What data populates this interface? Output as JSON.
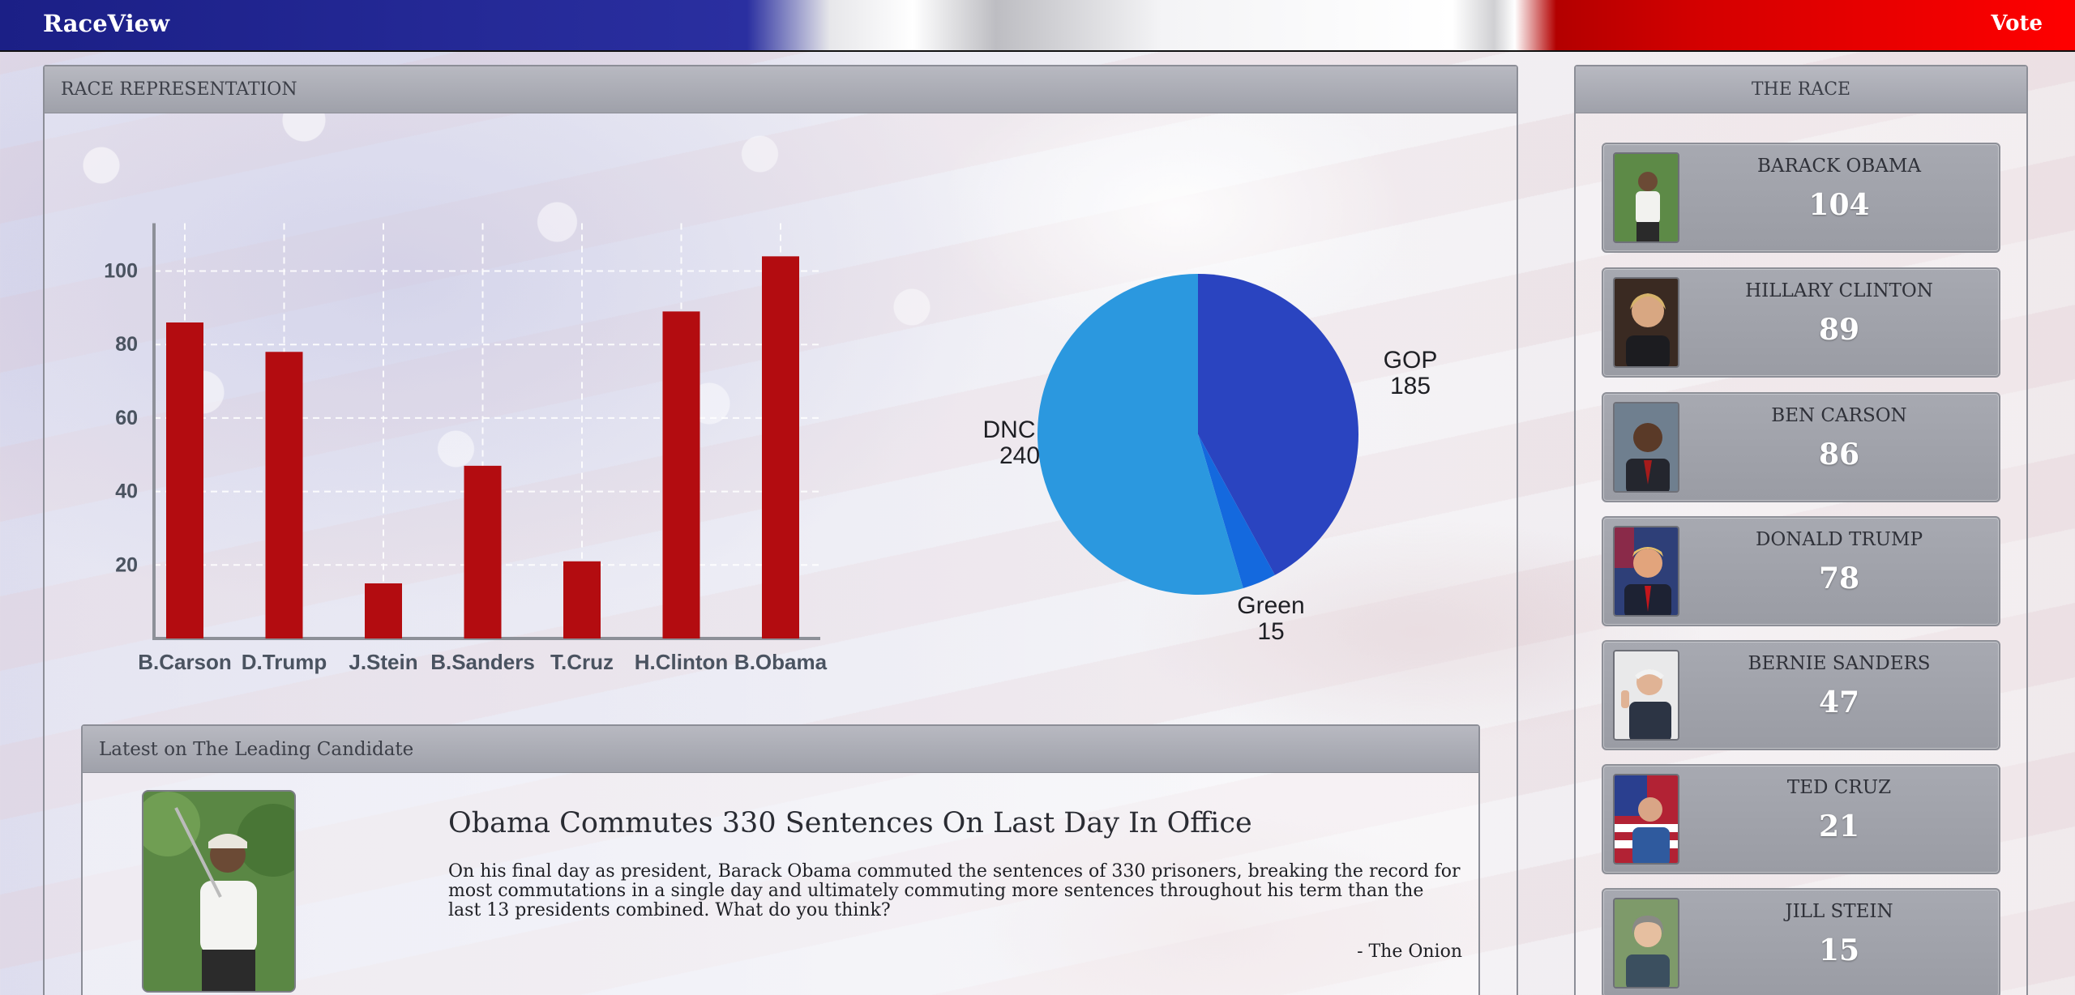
{
  "navbar": {
    "brand": "RaceView",
    "vote_label": "Vote"
  },
  "race_panel": {
    "title": "RACE REPRESENTATION"
  },
  "the_race_panel": {
    "title": "THE RACE"
  },
  "news": {
    "header": "Latest on The Leading Candidate",
    "title": "Obama Commutes 330 Sentences On Last Day In Office",
    "body": "On his final day as president, Barack Obama commuted the sentences of 330 prisoners, breaking the record for most commutations in a single day and ultimately commuting more sentences throughout his term than the last 13 presidents combined. What do you think?",
    "source": "- The Onion"
  },
  "candidates": [
    {
      "name": "BARACK OBAMA",
      "votes": "104"
    },
    {
      "name": "HILLARY CLINTON",
      "votes": "89"
    },
    {
      "name": "BEN CARSON",
      "votes": "86"
    },
    {
      "name": "DONALD TRUMP",
      "votes": "78"
    },
    {
      "name": "BERNIE SANDERS",
      "votes": "47"
    },
    {
      "name": "TED CRUZ",
      "votes": "21"
    },
    {
      "name": "JILL STEIN",
      "votes": "15"
    }
  ],
  "chart_data": [
    {
      "type": "bar",
      "categories": [
        "B.Carson",
        "D.Trump",
        "J.Stein",
        "B.Sanders",
        "T.Cruz",
        "H.Clinton",
        "B.Obama"
      ],
      "values": [
        86,
        78,
        15,
        47,
        21,
        89,
        104
      ],
      "yticks": [
        20,
        40,
        60,
        80,
        100
      ],
      "ylim": [
        0,
        113
      ],
      "grid": true,
      "bar_color": "#b30c10"
    },
    {
      "type": "pie",
      "slices": [
        {
          "label": "GOP",
          "value": 185,
          "color": "#2a44c0"
        },
        {
          "label": "Green",
          "value": 15,
          "color": "#1469de"
        },
        {
          "label": "DNC",
          "value": 240,
          "color": "#2b98df"
        }
      ]
    }
  ]
}
